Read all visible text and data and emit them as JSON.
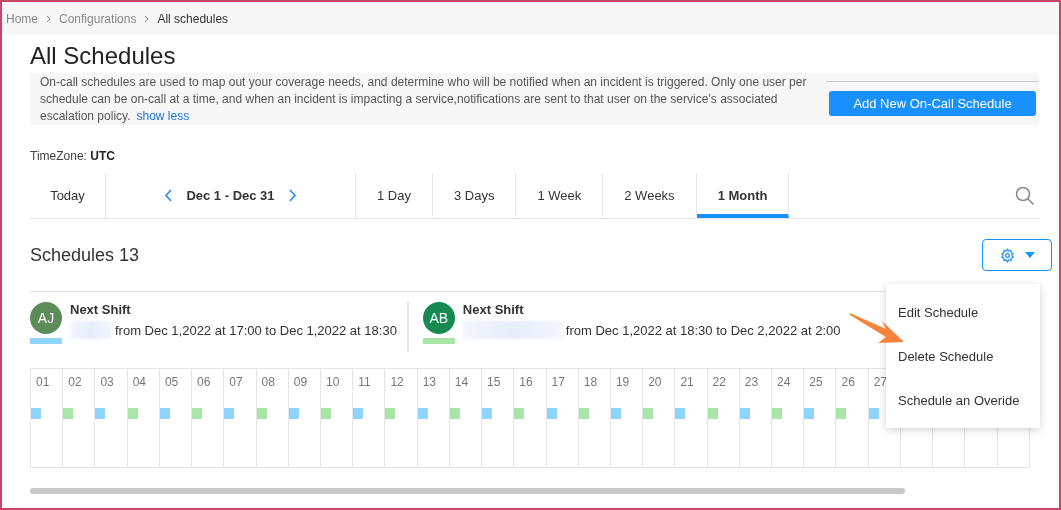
{
  "breadcrumb": [
    {
      "label": "Home",
      "current": false
    },
    {
      "label": "Configurations",
      "current": false
    },
    {
      "label": "All schedules",
      "current": true
    }
  ],
  "title": "All Schedules",
  "description": {
    "text": "On-call schedules are used to map out your coverage needs, and determine who will be notified when an incident is triggered. Only one user per schedule can be on-call at a time, and when an incident is impacting a service,notifications are sent to that user on the service’s associated escalation policy.",
    "link": "show less"
  },
  "add_button": "Add New On-Call Schedule",
  "timezone": {
    "label": "TimeZone:",
    "value": "UTC"
  },
  "toolbar": {
    "today": "Today",
    "range": "Dec 1 - Dec 31",
    "views": [
      {
        "label": "1 Day",
        "selected": false
      },
      {
        "label": "3 Days",
        "selected": false
      },
      {
        "label": "1 Week",
        "selected": false
      },
      {
        "label": "2 Weeks",
        "selected": false
      },
      {
        "label": "1 Month",
        "selected": true
      }
    ]
  },
  "schedules_title": "Schedules 13",
  "shifts": [
    {
      "initials": "AJ",
      "avatar": {
        "color": "#5b8c5a"
      },
      "marker": {
        "color": "#8fd3fe"
      },
      "title": "Next Shift",
      "text": "from Dec 1,2022 at 17:00 to Dec 1,2022 at 18:30"
    },
    {
      "initials": "AB",
      "avatar": {
        "color": "#178a52"
      },
      "marker": {
        "color": "#a8e6a8"
      },
      "title": "Next Shift",
      "text": "from Dec 1,2022 at 18:30 to Dec 2,2022 at 2:00"
    }
  ],
  "days": [
    {
      "label": "01",
      "color": "#8fd3fe"
    },
    {
      "label": "02",
      "color": "#a8e6a8"
    },
    {
      "label": "03",
      "color": "#8fd3fe"
    },
    {
      "label": "04",
      "color": "#a8e6a8"
    },
    {
      "label": "05",
      "color": "#8fd3fe"
    },
    {
      "label": "06",
      "color": "#a8e6a8"
    },
    {
      "label": "07",
      "color": "#8fd3fe"
    },
    {
      "label": "08",
      "color": "#a8e6a8"
    },
    {
      "label": "09",
      "color": "#8fd3fe"
    },
    {
      "label": "10",
      "color": "#a8e6a8"
    },
    {
      "label": "11",
      "color": "#8fd3fe"
    },
    {
      "label": "12",
      "color": "#a8e6a8"
    },
    {
      "label": "13",
      "color": "#8fd3fe"
    },
    {
      "label": "14",
      "color": "#a8e6a8"
    },
    {
      "label": "15",
      "color": "#8fd3fe"
    },
    {
      "label": "16",
      "color": "#a8e6a8"
    },
    {
      "label": "17",
      "color": "#8fd3fe"
    },
    {
      "label": "18",
      "color": "#a8e6a8"
    },
    {
      "label": "19",
      "color": "#8fd3fe"
    },
    {
      "label": "20",
      "color": "#a8e6a8"
    },
    {
      "label": "21",
      "color": "#8fd3fe"
    },
    {
      "label": "22",
      "color": "#a8e6a8"
    },
    {
      "label": "23",
      "color": "#8fd3fe"
    },
    {
      "label": "24",
      "color": "#a8e6a8"
    },
    {
      "label": "25",
      "color": "#8fd3fe"
    },
    {
      "label": "26",
      "color": "#a8e6a8"
    },
    {
      "label": "27",
      "color": "#8fd3fe"
    }
  ],
  "menu": [
    "Edit Schedule",
    "Delete Schedule",
    "Schedule an Overide"
  ]
}
